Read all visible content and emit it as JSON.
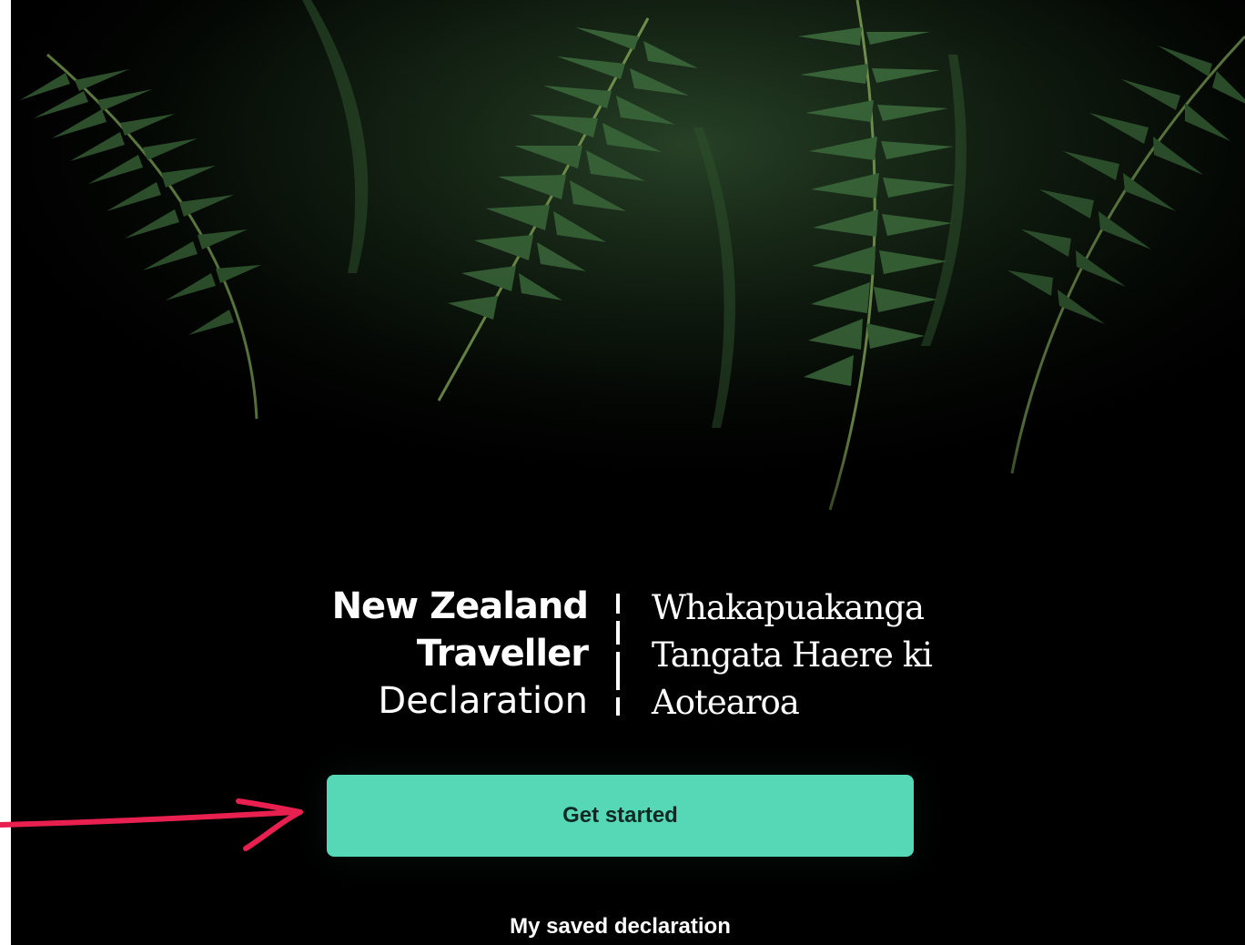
{
  "hero": {
    "background_icon": "fern-fronds-photo",
    "colors": {
      "background": "#000000",
      "fern_dark": "#17301a",
      "fern_light": "#3f6b3c"
    }
  },
  "logo": {
    "english_line1": "New Zealand",
    "english_line2": "Traveller",
    "english_line3": "Declaration",
    "maori_line1": "Whakapuakanga",
    "maori_line2": "Tangata Haere ki",
    "maori_line3": "Aotearoa"
  },
  "actions": {
    "get_started_label": "Get started",
    "saved_declaration_label": "My saved declaration"
  },
  "colors": {
    "accent": "#56d8b6",
    "annotation": "#e8204f"
  },
  "annotation": {
    "icon": "red-arrow-icon"
  }
}
